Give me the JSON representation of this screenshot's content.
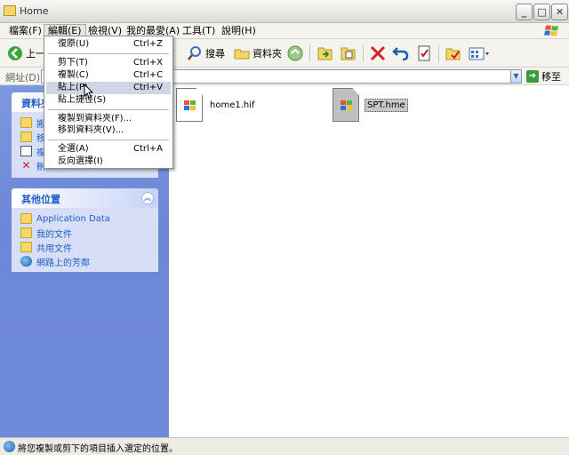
{
  "window": {
    "title": "Home"
  },
  "menubar": {
    "items": [
      "檔案(F)",
      "編輯(E)",
      "檢視(V)",
      "我的最愛(A)",
      "工具(T)",
      "說明(H)"
    ]
  },
  "toolbar": {
    "back_label": "上一",
    "search_label": "搜尋",
    "folders_label": "資料夾"
  },
  "address": {
    "label": "網址(D)",
    "value": "",
    "go_label": "移至"
  },
  "edit_menu": {
    "items": [
      {
        "label": "復原(U)",
        "shortcut": "Ctrl+Z"
      },
      {
        "label": "剪下(T)",
        "shortcut": "Ctrl+X"
      },
      {
        "label": "複製(C)",
        "shortcut": "Ctrl+C"
      },
      {
        "label": "貼上(P)",
        "shortcut": "Ctrl+V"
      },
      {
        "label": "貼上捷徑(S)",
        "shortcut": ""
      },
      {
        "label": "複製到資料夾(F)...",
        "shortcut": ""
      },
      {
        "label": "移到資料夾(V)...",
        "shortcut": ""
      },
      {
        "label": "全選(A)",
        "shortcut": "Ctrl+A"
      },
      {
        "label": "反向選擇(I)",
        "shortcut": ""
      }
    ],
    "highlighted": "貼上(P)"
  },
  "left_pane": {
    "tasks_panel": {
      "title": "資料夾",
      "links": [
        "搬",
        "移",
        "複",
        "刪"
      ]
    },
    "other_places": {
      "title": "其他位置",
      "links": [
        "Application Data",
        "我的文件",
        "共用文件",
        "網路上的芳鄰"
      ]
    }
  },
  "files": [
    {
      "name": "home1.hif",
      "selected": false
    },
    {
      "name": "SPT.hme",
      "selected": true
    }
  ],
  "status": {
    "text": "將您複製或剪下的項目插入選定的位置。"
  }
}
